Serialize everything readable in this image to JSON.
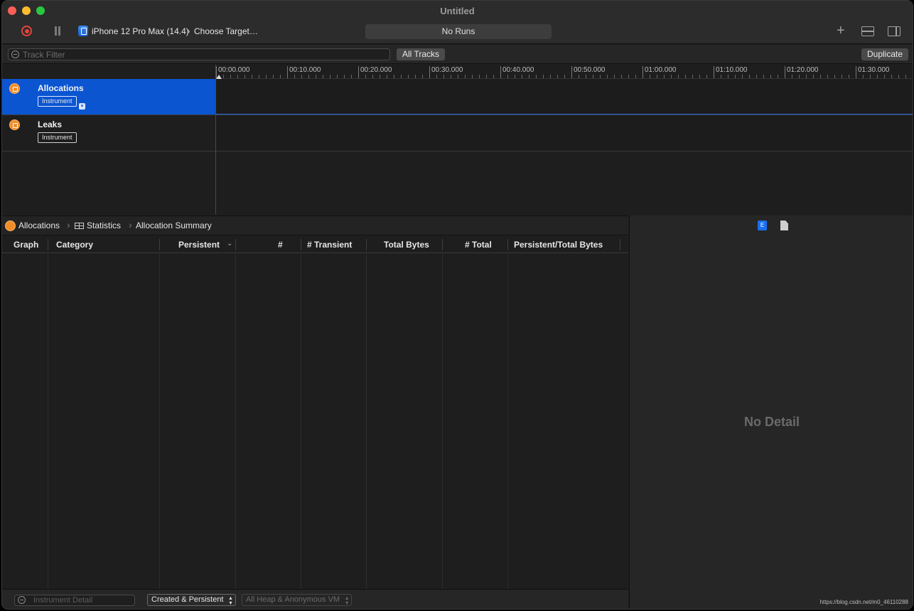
{
  "window": {
    "title": "Untitled"
  },
  "toolbar": {
    "device": "iPhone 12 Pro Max (14.4)",
    "target": "Choose Target…",
    "runs": "No Runs"
  },
  "filterbar": {
    "track_filter_placeholder": "Track Filter",
    "all_tracks": "All Tracks",
    "duplicate": "Duplicate"
  },
  "ruler": {
    "ticks": [
      "00:00.000",
      "00:10.000",
      "00:20.000",
      "00:30.000",
      "00:40.000",
      "00:50.000",
      "01:00.000",
      "01:10.000",
      "01:20.000",
      "01:30.000"
    ]
  },
  "tracks": [
    {
      "name": "Allocations",
      "type": "Instrument",
      "selected": true,
      "icon": "allocations-icon"
    },
    {
      "name": "Leaks",
      "type": "Instrument",
      "selected": false,
      "icon": "leaks-icon"
    }
  ],
  "breadcrumb": {
    "instrument": "Allocations",
    "view": "Statistics",
    "detail": "Allocation Summary"
  },
  "table": {
    "columns": [
      "Graph",
      "Category",
      "Persistent",
      "#",
      "# Transient",
      "Total Bytes",
      "# Total",
      "Persistent/Total Bytes"
    ]
  },
  "footer": {
    "detail_filter_placeholder": "Instrument Detail",
    "lifespan": "Created & Persistent",
    "allocation_type": "All Heap & Anonymous VM"
  },
  "inspector": {
    "tab_extended": "E",
    "empty_text": "No Detail"
  },
  "watermark": "https://blog.csdn.net/m0_46110288",
  "colors": {
    "accent": "#0b55d1",
    "record": "#e6453c",
    "instrument_icon": "#f28c28"
  }
}
